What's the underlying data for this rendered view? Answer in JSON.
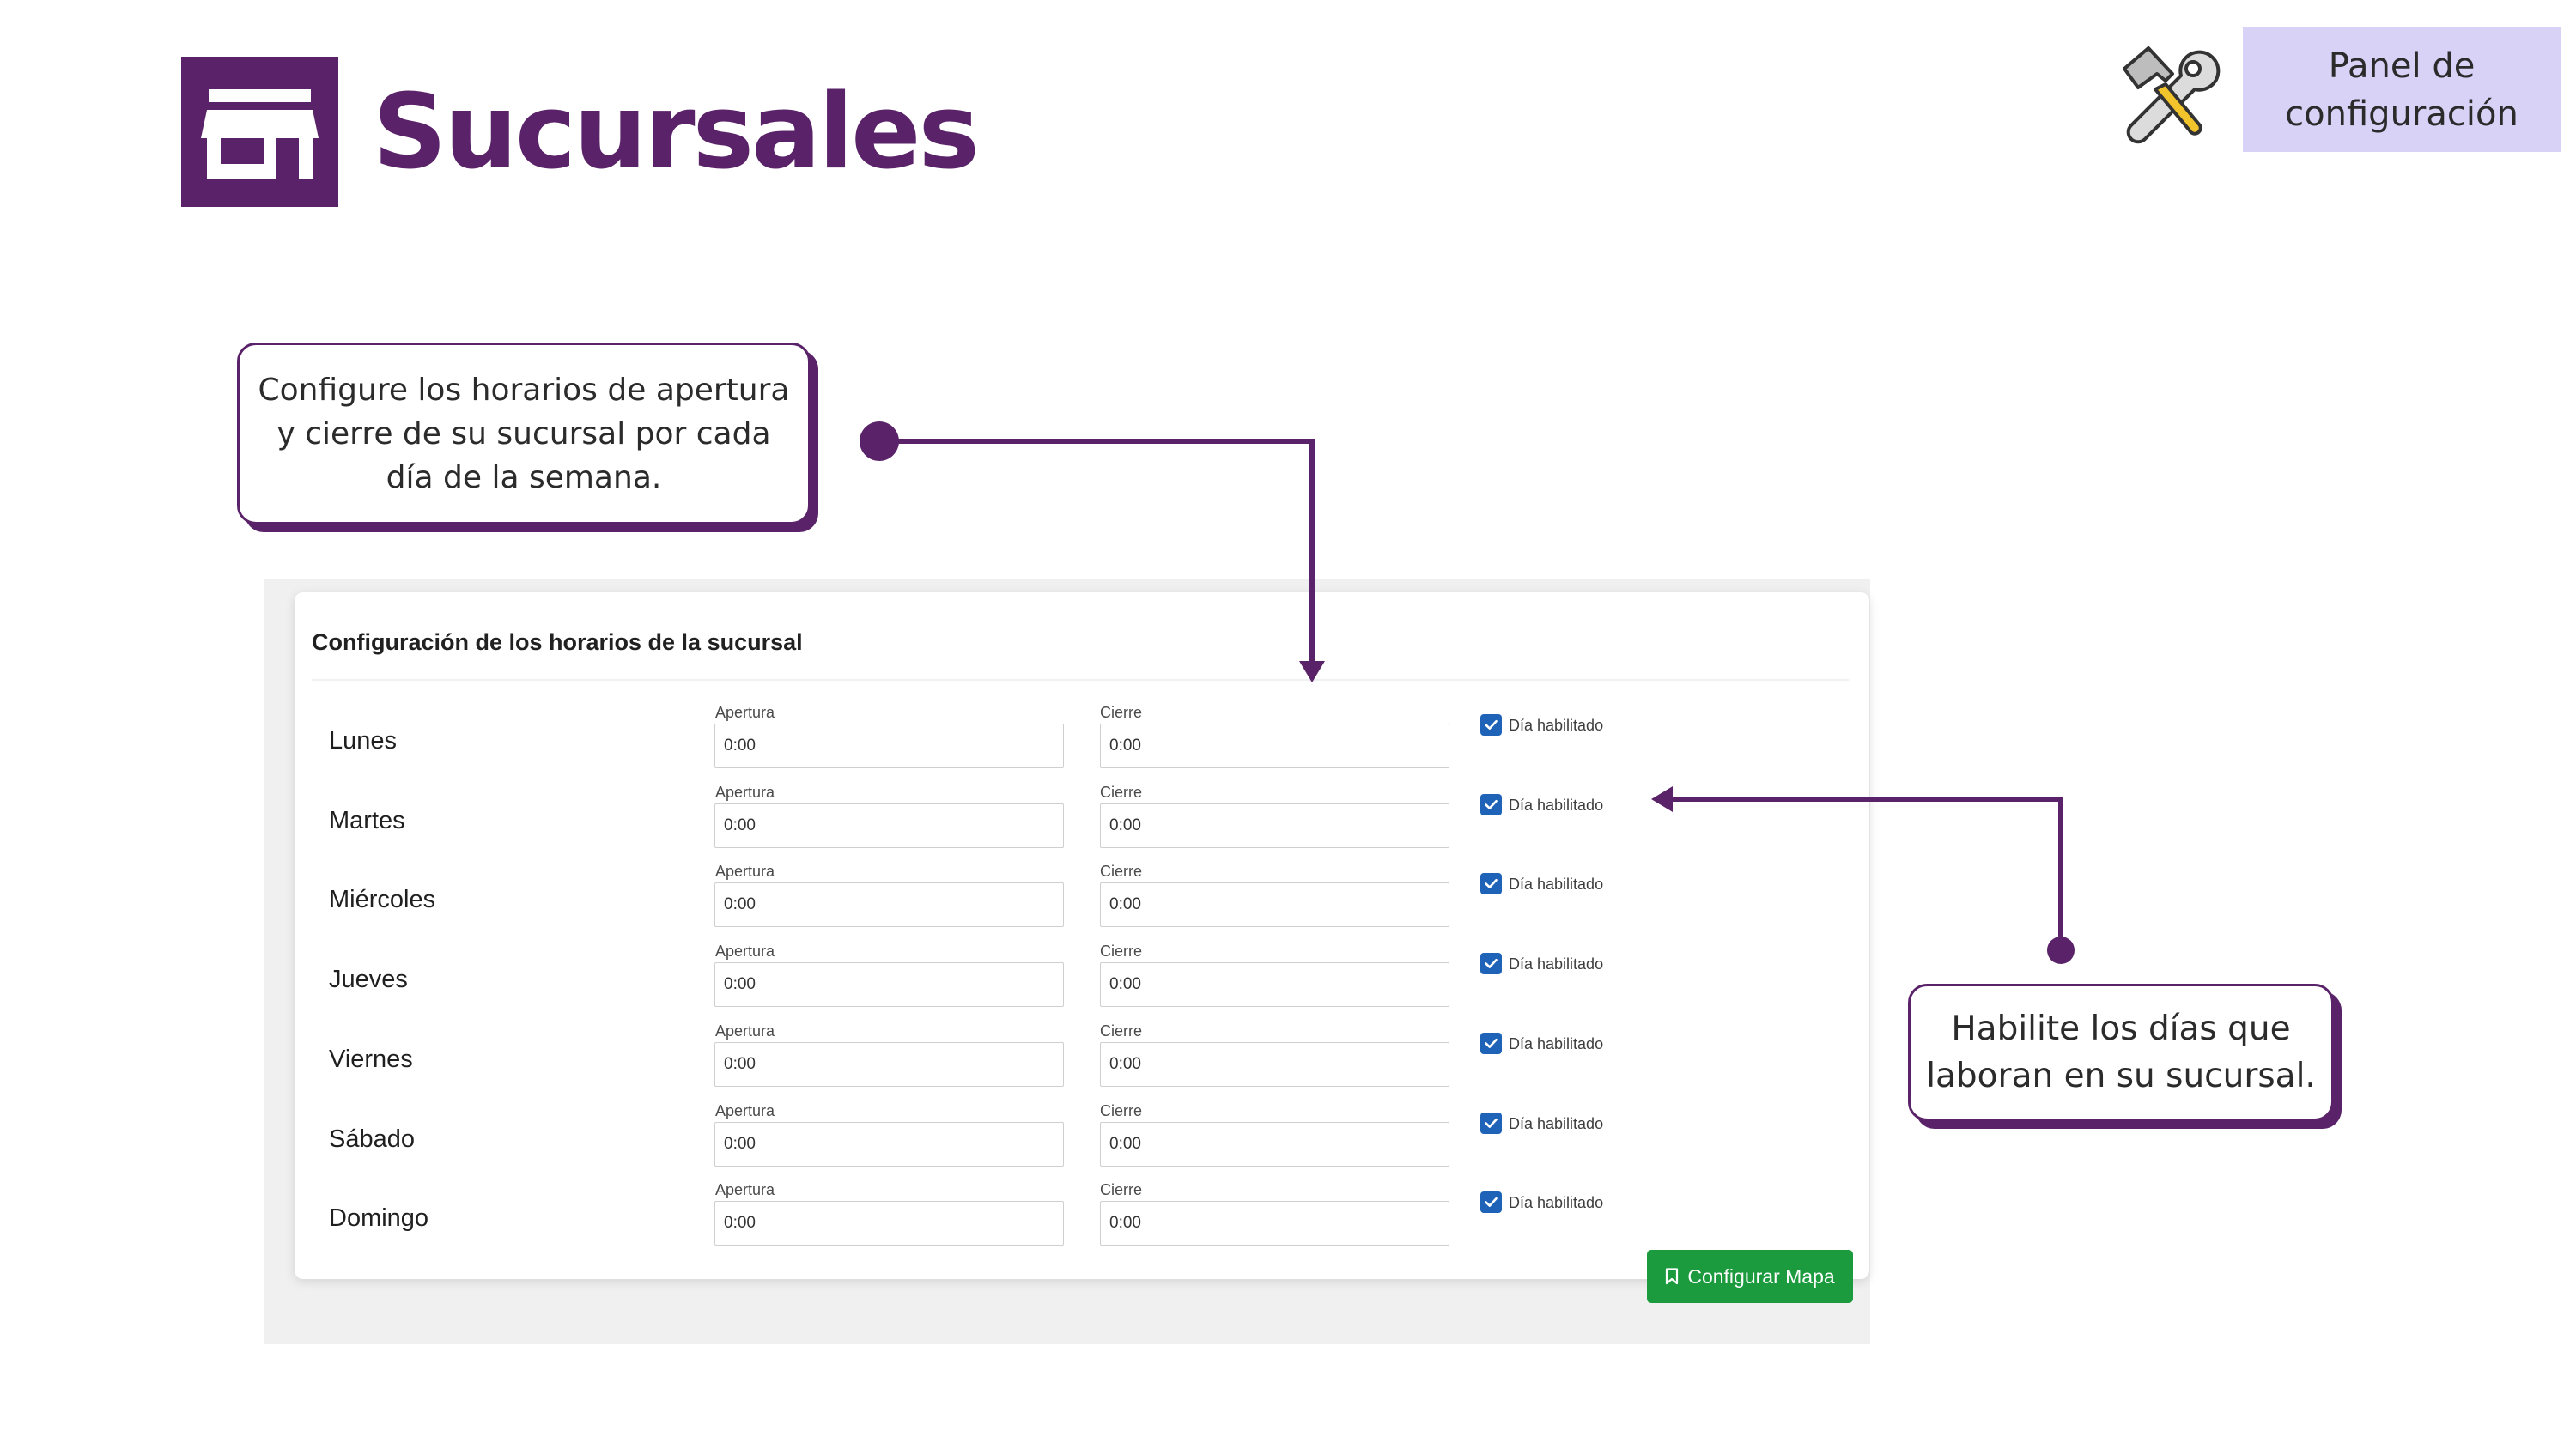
{
  "header": {
    "title": "Sucursales",
    "panel_badge": "Panel de configuración",
    "logo_icon": "store-icon",
    "tools_icon": "tools-icon"
  },
  "callouts": {
    "hours_text": "Configure los horarios de apertura y cierre de su sucursal por cada día de la semana.",
    "days_text": "Habilite los días que laboran en su sucursal."
  },
  "form": {
    "title": "Configuración de los horarios de la sucursal",
    "open_label": "Apertura",
    "close_label": "Cierre",
    "enabled_label": "Día habilitado",
    "days": [
      {
        "name": "Lunes",
        "open": "0:00",
        "close": "0:00",
        "enabled": true
      },
      {
        "name": "Martes",
        "open": "0:00",
        "close": "0:00",
        "enabled": true
      },
      {
        "name": "Miércoles",
        "open": "0:00",
        "close": "0:00",
        "enabled": true
      },
      {
        "name": "Jueves",
        "open": "0:00",
        "close": "0:00",
        "enabled": true
      },
      {
        "name": "Viernes",
        "open": "0:00",
        "close": "0:00",
        "enabled": true
      },
      {
        "name": "Sábado",
        "open": "0:00",
        "close": "0:00",
        "enabled": true
      },
      {
        "name": "Domingo",
        "open": "0:00",
        "close": "0:00",
        "enabled": true
      }
    ],
    "map_button": "Configurar Mapa"
  },
  "colors": {
    "brand_purple": "#5a2268",
    "badge_lavender": "#d9d2f7",
    "checkbox_blue": "#1e63b8",
    "button_green": "#1b9a3e"
  }
}
